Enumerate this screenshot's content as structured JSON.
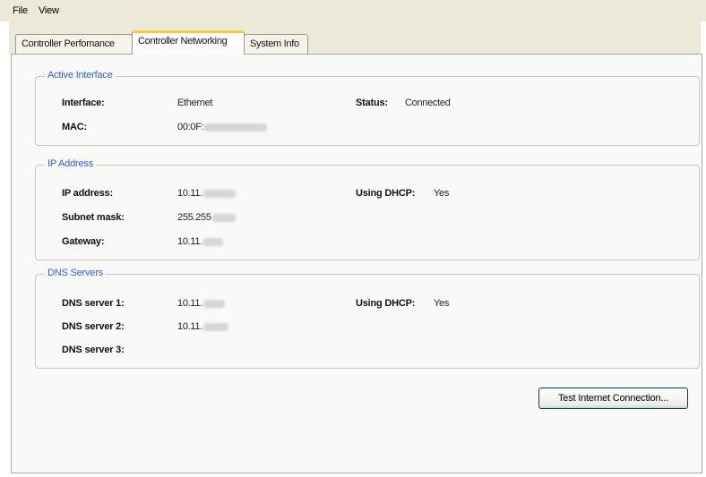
{
  "menu": {
    "file": "File",
    "view": "View"
  },
  "tabs": {
    "performance": "Controller Perfomance",
    "networking": "Controller Networking",
    "system_info": "System Info"
  },
  "active_interface": {
    "title": "Active Interface",
    "interface_label": "Interface:",
    "interface_value": "Ethernet",
    "status_label": "Status:",
    "status_value": "Connected",
    "mac_label": "MAC:",
    "mac_value": "00:0F:"
  },
  "ip_address": {
    "title": "IP Address",
    "ip_label": "IP address:",
    "ip_value": "10.11.",
    "subnet_label": "Subnet mask:",
    "subnet_value": "255.255",
    "gateway_label": "Gateway:",
    "gateway_value": "10.11.",
    "dhcp_label": "Using DHCP:",
    "dhcp_value": "Yes"
  },
  "dns": {
    "title": "DNS Servers",
    "dns1_label": "DNS server 1:",
    "dns1_value": "10.11.",
    "dns2_label": "DNS server 2:",
    "dns2_value": "10.11.",
    "dns3_label": "DNS server 3:",
    "dhcp_label": "Using DHCP:",
    "dhcp_value": "Yes"
  },
  "actions": {
    "test_connection": "Test Internet Connection..."
  }
}
